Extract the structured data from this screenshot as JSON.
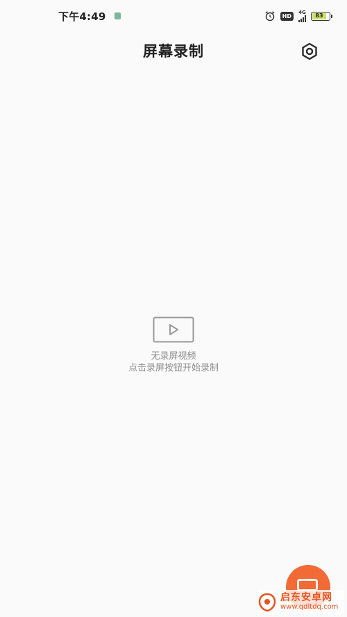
{
  "status_bar": {
    "time": "下午4:49",
    "hd_label": "HD",
    "network_label": "4G",
    "battery_level": "83"
  },
  "header": {
    "title": "屏幕录制",
    "settings_icon": "hexagon-settings-icon"
  },
  "empty_state": {
    "icon": "video-play-icon",
    "title": "无录屏视频",
    "hint": "点击录屏按钮开始录制"
  },
  "fab": {
    "icon": "record-icon",
    "color": "#f26b36"
  },
  "watermark": {
    "name": "启东安卓网",
    "url": "www.qdltdq.com",
    "color": "#e8531e"
  }
}
